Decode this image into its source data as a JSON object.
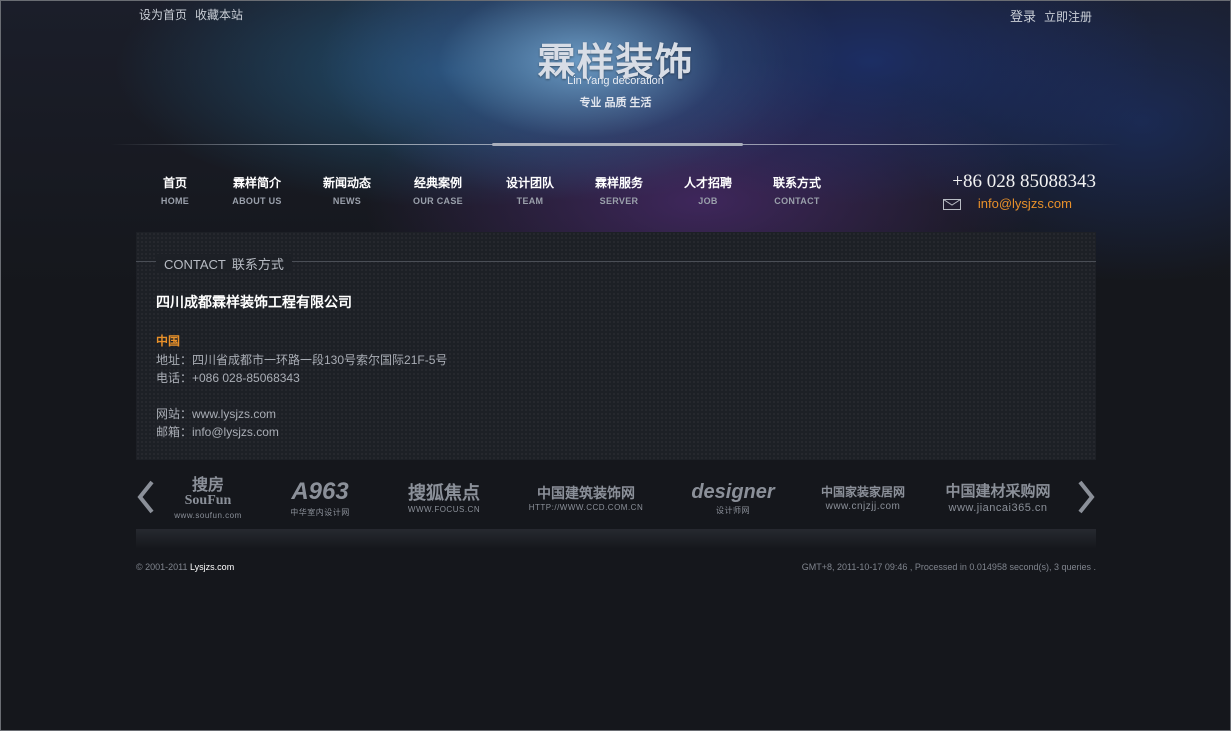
{
  "top_links": {
    "left": [
      "设为首页",
      "收藏本站"
    ],
    "right": [
      "登录",
      "立即注册"
    ]
  },
  "logo": {
    "title": "霖样装饰",
    "subtitle": "Lin Yang decoration",
    "slogan": "专业 品质 生活"
  },
  "nav": [
    {
      "cn": "首页",
      "en": "HOME"
    },
    {
      "cn": "霖样简介",
      "en": "ABOUT US"
    },
    {
      "cn": "新闻动态",
      "en": "NEWS"
    },
    {
      "cn": "经典案例",
      "en": "OUR CASE"
    },
    {
      "cn": "设计团队",
      "en": "TEAM"
    },
    {
      "cn": "霖样服务",
      "en": "SERVER"
    },
    {
      "cn": "人才招聘",
      "en": "JOB"
    },
    {
      "cn": "联系方式",
      "en": "CONTACT"
    }
  ],
  "contact_header": {
    "phone": "+86 028 85088343",
    "email": "info@lysjzs.com"
  },
  "panel": {
    "title_en": "CONTACT",
    "title_cn": "联系方式",
    "company": "四川成都霖样装饰工程有限公司",
    "country": "中国",
    "address": "地址：四川省成都市一环路一段130号索尔国际21F-5号",
    "tel": "电话：+086 028-85068343",
    "website": "网站：www.lysjzs.com",
    "mail": "邮箱：info@lysjzs.com"
  },
  "partners": [
    {
      "name": "搜房",
      "sub": "www.soufun.com",
      "alt": "SouFun"
    },
    {
      "name": "A963",
      "sub": "中华室内设计网"
    },
    {
      "name": "搜狐焦点",
      "sub": "WWW.FOCUS.CN"
    },
    {
      "name": "中国建筑装饰网",
      "sub": "HTTP://WWW.CCD.COM.CN"
    },
    {
      "name": "designer",
      "sub": "设计师网"
    },
    {
      "name": "中国家装家居网",
      "sub": "www.cnjzjj.com"
    },
    {
      "name": "中国建材采购网",
      "sub": "www.jiancai365.cn"
    }
  ],
  "footer": {
    "copyright": "© 2001-2011 ",
    "site": "Lysjzs.com",
    "stats": "GMT+8, 2011-10-17 09:46 , Processed in 0.014958 second(s), 3 queries ."
  },
  "colors": {
    "accent_orange": "#e8902a",
    "background": "#15171c",
    "panel": "#1d2026"
  }
}
